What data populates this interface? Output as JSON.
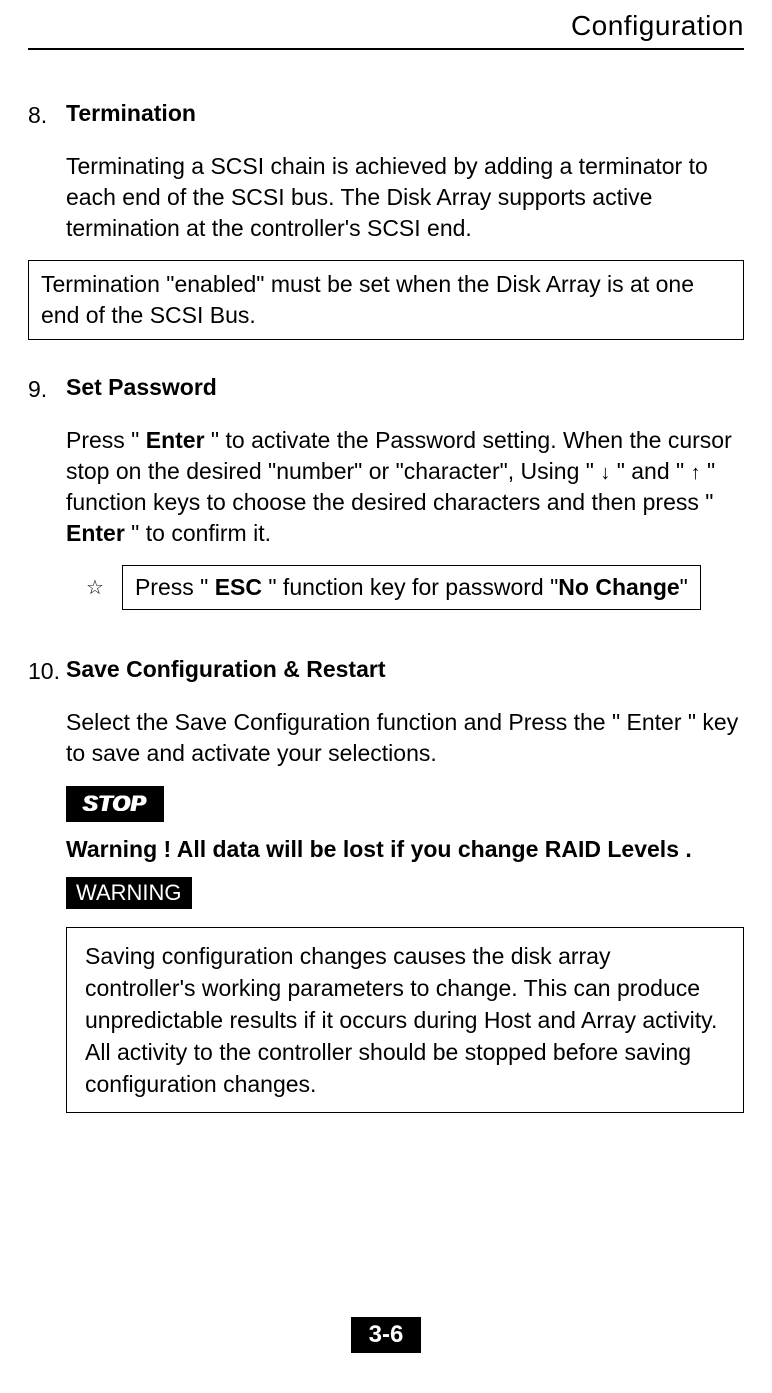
{
  "header": {
    "title": "Configuration"
  },
  "sections": [
    {
      "num": "8.",
      "title": "Termination",
      "para1": "Terminating a SCSI chain is achieved by adding a terminator to each end of the SCSI bus. The Disk Array supports active termination at the controller's SCSI end.",
      "box": "Termination \"enabled\" must be set when the Disk Array is at one end of the SCSI Bus."
    },
    {
      "num": "9.",
      "title": "Set Password",
      "para_parts": {
        "p1": "Press \" ",
        "enter1": "Enter",
        "p2": " \" to activate the Password setting. When the cursor stop on the desired \"number\" or \"character\", Using \" ",
        "p3": " \" and \" ",
        "p4": " \" function keys to choose the desired characters and then press \" ",
        "enter2": "Enter",
        "p5": " \" to confirm it."
      },
      "note": {
        "p1": "Press \" ",
        "esc": "ESC",
        "p2": " \" function key for password \"",
        "nochange": "No Change",
        "p3": "\""
      }
    },
    {
      "num": "10.",
      "title": "Save Configuration & Restart",
      "para1": "Select the Save Configuration function and Press the \" Enter \" key to save and activate your selections.",
      "stop_label": "STOP",
      "warn_line": "Warning ! All data will be lost if you change RAID Levels .",
      "warning_label": "WARNING",
      "box": "Saving configuration changes causes the disk array controller's working parameters to change. This can produce unpredictable results if it occurs during Host and Array activity. All activity to the controller should be stopped before saving configuration changes."
    }
  ],
  "footer": {
    "page": "3-6"
  }
}
